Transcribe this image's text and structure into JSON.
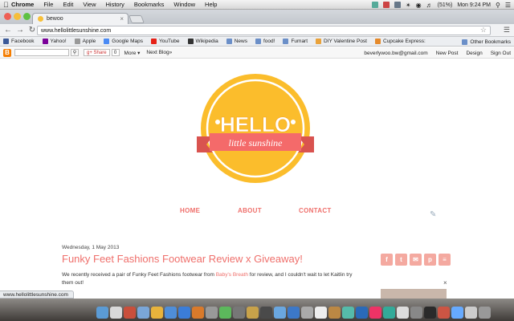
{
  "menubar": {
    "app": "Chrome",
    "menus": [
      "File",
      "Edit",
      "View",
      "History",
      "Bookmarks",
      "Window",
      "Help"
    ],
    "battery": "(51%)",
    "clock": "Mon 9:24 PM"
  },
  "tab": {
    "title": "bewoo"
  },
  "toolbar": {
    "url": "www.hellolittlesunshine.com"
  },
  "bookmarks": {
    "items": [
      {
        "label": "Facebook",
        "color": "#3b5998"
      },
      {
        "label": "Yahoo!",
        "color": "#7b0099"
      },
      {
        "label": "Apple",
        "color": "#999999"
      },
      {
        "label": "Google Maps",
        "color": "#4a8af4"
      },
      {
        "label": "YouTube",
        "color": "#e62117"
      },
      {
        "label": "Wikipedia",
        "color": "#333333"
      },
      {
        "label": "News",
        "color": "#6b8fc8"
      },
      {
        "label": "food!",
        "color": "#6b8fc8"
      },
      {
        "label": "Fumart",
        "color": "#6b8fc8"
      },
      {
        "label": "DIY Valentine Post",
        "color": "#e9a23b"
      },
      {
        "label": "Cupcake Express:",
        "color": "#e58a2b"
      }
    ],
    "other": "Other Bookmarks"
  },
  "blogger_nav": {
    "share": "Share",
    "count": "0",
    "more": "More ▾",
    "next_blog": "Next Blog»",
    "email": "beverlywoo.bw@gmail.com",
    "new_post": "New Post",
    "design": "Design",
    "sign_out": "Sign Out"
  },
  "logo": {
    "line1": "HELLO",
    "line2": "little sunshine",
    "circle_color": "#fbbd2c",
    "ribbon_color": "#f46a6a"
  },
  "site_nav": {
    "home": "HOME",
    "about": "ABOUT",
    "contact": "CONTACT"
  },
  "post": {
    "date": "Wednesday, 1 May 2013",
    "title": "Funky Feet Fashions Footwear Review x Giveaway!",
    "body_prefix": "We recently received a pair of Funky Feet Fashions footwear from ",
    "body_link": "Baby's Breath",
    "body_suffix": " for review, and I couldn't wait to let Kaitlin try them out!"
  },
  "social": [
    {
      "icon": "facebook-icon",
      "glyph": "f"
    },
    {
      "icon": "twitter-icon",
      "glyph": "t"
    },
    {
      "icon": "email-icon",
      "glyph": "✉"
    },
    {
      "icon": "pinterest-icon",
      "glyph": "p"
    },
    {
      "icon": "rss-icon",
      "glyph": "≡"
    }
  ],
  "status": {
    "url": "www.hellolittlesunshine.com"
  }
}
